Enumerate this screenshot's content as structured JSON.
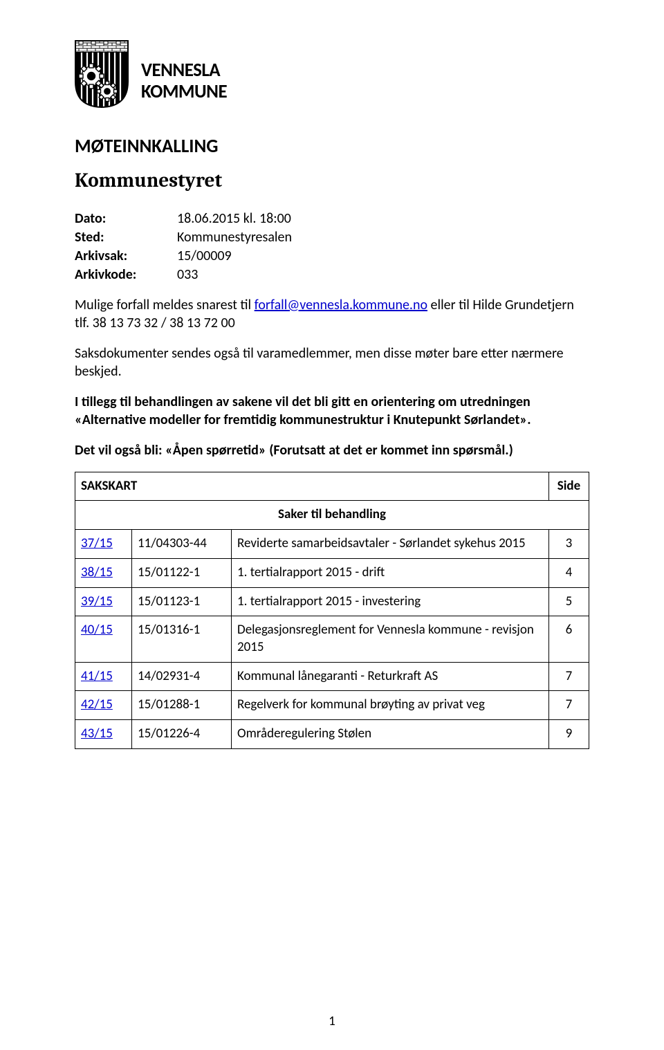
{
  "org": {
    "name_line1": "VENNESLA",
    "name_line2": "KOMMUNE"
  },
  "doc": {
    "title": "MØTEINNKALLING",
    "subtitle": "Kommunestyret",
    "page_number": "1"
  },
  "meta": {
    "dato_label": "Dato:",
    "dato_value": "18.06.2015 kl. 18:00",
    "sted_label": "Sted:",
    "sted_value": "Kommunestyresalen",
    "arkivsak_label": "Arkivsak:",
    "arkivsak_value": "15/00009",
    "arkivkode_label": "Arkivkode:",
    "arkivkode_value": "033"
  },
  "intro": {
    "p1a": "Mulige forfall meldes snarest til ",
    "email": "forfall@vennesla.kommune.no",
    "p1b": " eller til Hilde Grundetjern tlf. 38 13 73 32 / 38 13 72 00",
    "p2": "Saksdokumenter sendes også til varamedlemmer, men disse møter bare etter nærmere beskjed.",
    "p3": "I tillegg til behandlingen av sakene vil det bli gitt en orientering om utredningen «Alternative modeller for fremtidig kommunestruktur i Knutepunkt Sørlandet».",
    "p4": "Det vil også bli: «Åpen spørretid» (Forutsatt at det er kommet inn spørsmål.)"
  },
  "table": {
    "header_left": "SAKSKART",
    "header_right": "Side",
    "section_label": "Saker til behandling",
    "rows": [
      {
        "case": "37/15",
        "doc": "11/04303-44",
        "title": "Reviderte samarbeidsavtaler - Sørlandet sykehus 2015",
        "side": "3"
      },
      {
        "case": "38/15",
        "doc": "15/01122-1",
        "title": "1. tertialrapport 2015 - drift",
        "side": "4"
      },
      {
        "case": "39/15",
        "doc": "15/01123-1",
        "title": "1. tertialrapport 2015 - investering",
        "side": "5"
      },
      {
        "case": "40/15",
        "doc": "15/01316-1",
        "title": "Delegasjonsreglement for Vennesla kommune - revisjon 2015",
        "side": "6"
      },
      {
        "case": "41/15",
        "doc": "14/02931-4",
        "title": "Kommunal lånegaranti - Returkraft AS",
        "side": "7"
      },
      {
        "case": "42/15",
        "doc": "15/01288-1",
        "title": "Regelverk for kommunal brøyting av privat veg",
        "side": "7"
      },
      {
        "case": "43/15",
        "doc": "15/01226-4",
        "title": "Områderegulering Stølen",
        "side": "9"
      }
    ]
  }
}
